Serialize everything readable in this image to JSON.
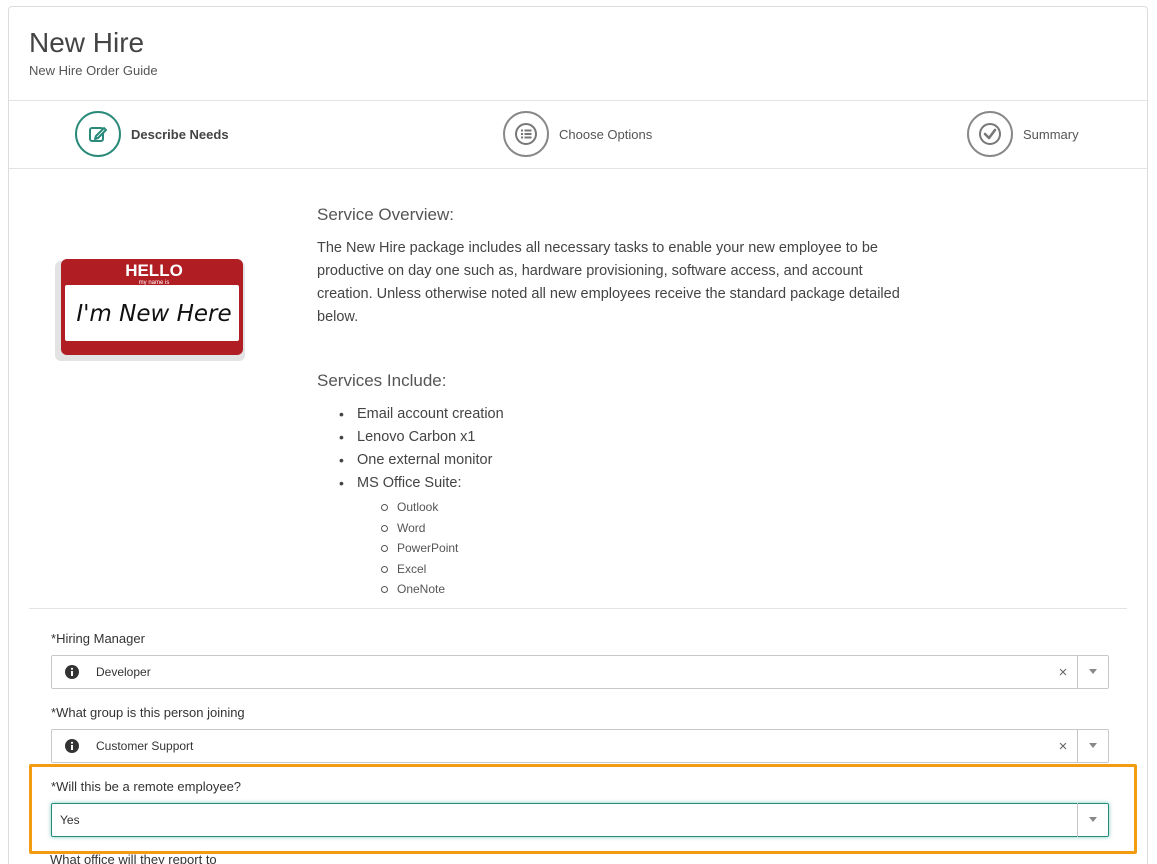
{
  "header": {
    "title": "New Hire",
    "subtitle": "New Hire Order Guide"
  },
  "steps": [
    {
      "label": "Describe Needs",
      "icon": "pencil-icon",
      "active": true
    },
    {
      "label": "Choose Options",
      "icon": "list-icon",
      "active": false
    },
    {
      "label": "Summary",
      "icon": "checkmark-icon",
      "active": false
    }
  ],
  "badge": {
    "hello": "HELLO",
    "my_name_is": "my name is",
    "name": "I'm New Here"
  },
  "overview": {
    "heading": "Service Overview:",
    "text": "The New Hire package includes all necessary tasks to enable your new employee to be productive on day one such as, hardware provisioning, software access, and account creation.  Unless otherwise noted all new employees receive the standard package detailed below."
  },
  "services": {
    "heading": "Services Include:",
    "items": [
      "Email account creation",
      "Lenovo Carbon x1",
      "One external monitor",
      "MS Office Suite:"
    ],
    "office_items": [
      "Outlook",
      "Word",
      "PowerPoint",
      "Excel",
      "OneNote"
    ]
  },
  "form": {
    "hiring_manager": {
      "label": "Hiring Manager",
      "value": "Developer"
    },
    "group": {
      "label": "What group is this person joining",
      "value": "Customer Support"
    },
    "remote": {
      "label": "Will this be a remote employee?",
      "value": "Yes"
    },
    "office": {
      "label": "What office will they report to"
    },
    "required_mark": "*",
    "clear_glyph": "×"
  },
  "colors": {
    "accent": "#2a8a7a",
    "highlight": "#f39c12",
    "badge_red": "#b01e23"
  }
}
